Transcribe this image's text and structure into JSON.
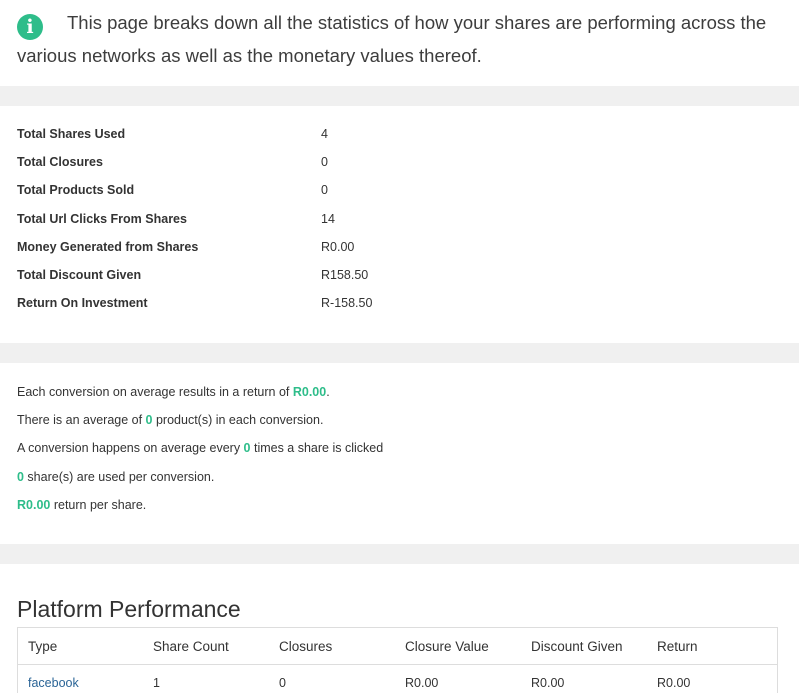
{
  "intro": {
    "icon": "info-icon",
    "text": "This page breaks down all the statistics of how your shares are performing across the various networks as well as the monetary values thereof."
  },
  "stats": [
    {
      "label": "Total Shares Used",
      "value": "4"
    },
    {
      "label": "Total Closures",
      "value": "0"
    },
    {
      "label": "Total Products Sold",
      "value": "0"
    },
    {
      "label": "Total Url Clicks From Shares",
      "value": "14"
    },
    {
      "label": "Money Generated from Shares",
      "value": "R0.00"
    },
    {
      "label": "Total Discount Given",
      "value": "R158.50"
    },
    {
      "label": "Return On Investment",
      "value": "R-158.50"
    }
  ],
  "conversions": {
    "line1": {
      "pre": "Each conversion on average results in a return of ",
      "value": "R0.00",
      "post": "."
    },
    "line2": {
      "pre": "There is an average of ",
      "value": "0",
      "post": " product(s) in each conversion."
    },
    "line3": {
      "pre": "A conversion happens on average every ",
      "value": "0",
      "post": " times a share is clicked"
    },
    "line4": {
      "value": "0",
      "post": " share(s) are used per conversion."
    },
    "line5": {
      "value": "R0.00",
      "post": " return per share."
    }
  },
  "platform": {
    "title": "Platform Performance",
    "columns": [
      "Type",
      "Share Count",
      "Closures",
      "Closure Value",
      "Discount Given",
      "Return"
    ],
    "rows": [
      [
        "facebook",
        "1",
        "0",
        "R0.00",
        "R0.00",
        "R0.00"
      ]
    ]
  },
  "colors": {
    "accent": "#2ebd8a",
    "link": "#2a6496",
    "separator": "#f0f0f0"
  }
}
